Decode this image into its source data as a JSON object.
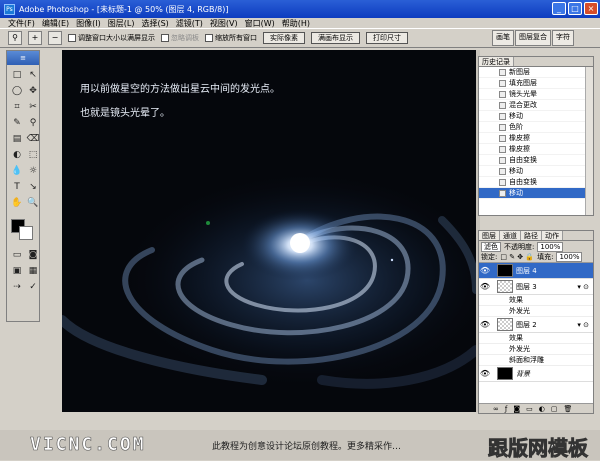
{
  "window": {
    "title": "Adobe Photoshop - [未标题-1 @ 50% (图层 4, RGB/8)]"
  },
  "menu": [
    "文件(F)",
    "编辑(E)",
    "图像(I)",
    "图层(L)",
    "选择(S)",
    "滤镜(T)",
    "视图(V)",
    "窗口(W)",
    "帮助(H)"
  ],
  "options": {
    "chk1": "调整窗口大小以满屏显示",
    "chk2": "忽略调板",
    "chk3": "缩放所有窗口",
    "btn1": "实际像素",
    "btn2": "满画布显示",
    "btn3": "打印尺寸"
  },
  "palette_well": [
    "画笔",
    "图层复合",
    "字符"
  ],
  "toolbox_tools": [
    "□",
    "↖",
    "◯",
    "✥",
    "⌗",
    "✂",
    "✎",
    "⚲",
    "▤",
    "⌫",
    "◐",
    "⬚",
    "💧",
    "☼",
    "T",
    "↘",
    "✋",
    "🔍"
  ],
  "canvas": {
    "line1": "用以前做星空的方法做出星云中间的发光点。",
    "line2": "也就是镜头光晕了。"
  },
  "history": {
    "tab": "历史记录",
    "items": [
      "新图层",
      "填充图层",
      "镜头光晕",
      "混合更改",
      "移动",
      "色阶",
      "橡皮擦",
      "橡皮擦",
      "自由变换",
      "移动",
      "自由变换",
      "移动"
    ]
  },
  "layers": {
    "tabs": [
      "图层",
      "通道",
      "路径",
      "动作"
    ],
    "blend_mode": "滤色",
    "opacity_label": "不透明度:",
    "opacity": "100%",
    "lock_label": "锁定:",
    "fill_label": "填充:",
    "fill": "100%",
    "rows": [
      {
        "name": "图层 4",
        "active": true,
        "fx": ""
      },
      {
        "name": "图层 3",
        "active": false,
        "fx": "▾ ⊙"
      },
      {
        "name": "图层 2",
        "active": false,
        "fx": "▾ ⊙"
      },
      {
        "name": "背景",
        "active": false,
        "fx": ""
      }
    ],
    "effects_label": "效果",
    "effect_outer_glow": "外发光",
    "effect_bevel": "斜面和浮雕"
  },
  "footer": {
    "brand": "VICNC.COM",
    "notice": "此教程为创意设计论坛原创教程。更多精采作…",
    "watermark": "跟版网模板"
  }
}
